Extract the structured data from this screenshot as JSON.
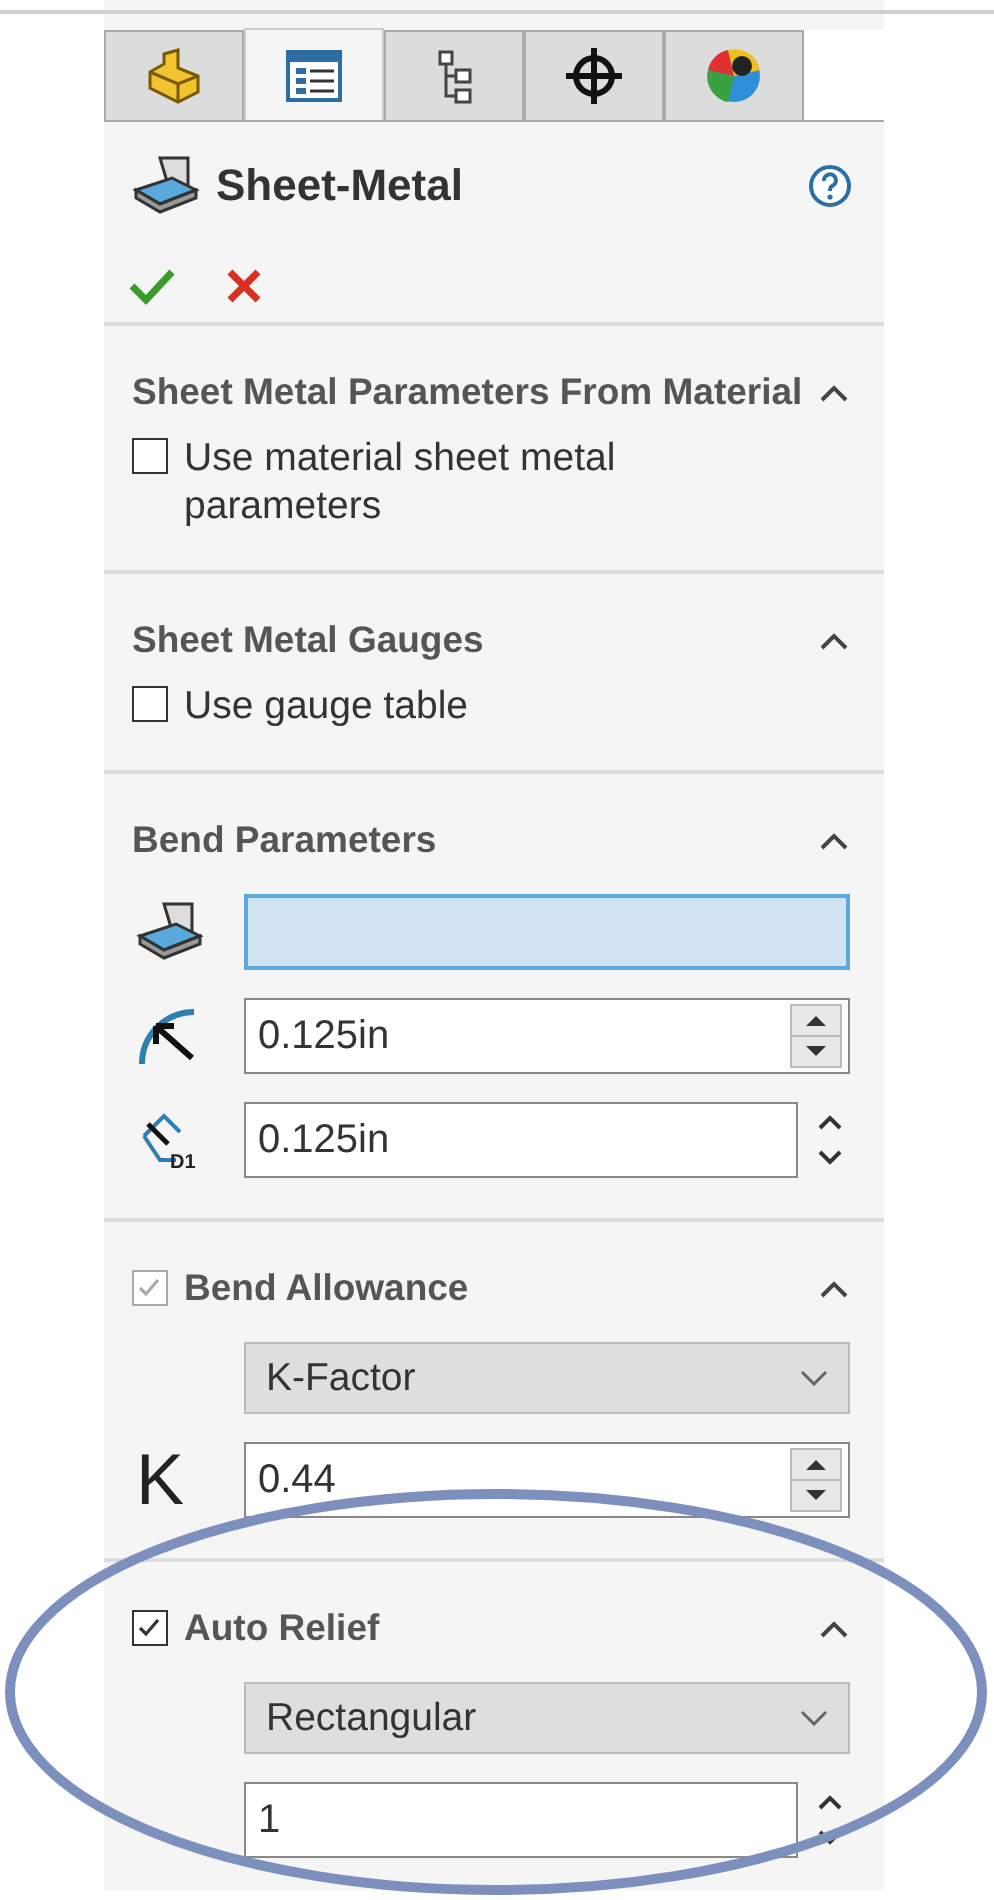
{
  "tabs": [
    {
      "kind": "feature",
      "selected": false
    },
    {
      "kind": "property",
      "selected": true
    },
    {
      "kind": "config",
      "selected": false
    },
    {
      "kind": "dimxpert",
      "selected": false
    },
    {
      "kind": "appearance",
      "selected": false
    }
  ],
  "title": "Sheet-Metal",
  "sections": [
    {
      "title": "Sheet Metal Parameters From Material",
      "expanded": true,
      "rows": [
        {
          "kind": "checkbox",
          "label": "Use material sheet metal parameters",
          "checked": false
        }
      ]
    },
    {
      "title": "Sheet Metal Gauges",
      "expanded": true,
      "rows": [
        {
          "kind": "checkbox",
          "label": "Use gauge table",
          "checked": false
        }
      ]
    },
    {
      "title": "Bend Parameters",
      "expanded": true,
      "rows": [
        {
          "kind": "selection",
          "active": true
        },
        {
          "kind": "radius",
          "value": "0.125in"
        },
        {
          "kind": "thickness",
          "icon_label": "D1",
          "value": "0.125in"
        }
      ]
    },
    {
      "title": "Bend Allowance",
      "expanded": true,
      "checkbox": {
        "checked": true,
        "disabled": true
      },
      "rows": [
        {
          "kind": "dropdown",
          "value": "K-Factor"
        },
        {
          "kind": "factor",
          "icon_label": "K",
          "value": "0.44"
        }
      ]
    },
    {
      "title": "Auto Relief",
      "expanded": true,
      "checkbox": {
        "checked": true,
        "disabled": false
      },
      "rows": [
        {
          "kind": "dropdown",
          "value": "Rectangular"
        },
        {
          "kind": "number",
          "value": "1"
        }
      ]
    }
  ]
}
